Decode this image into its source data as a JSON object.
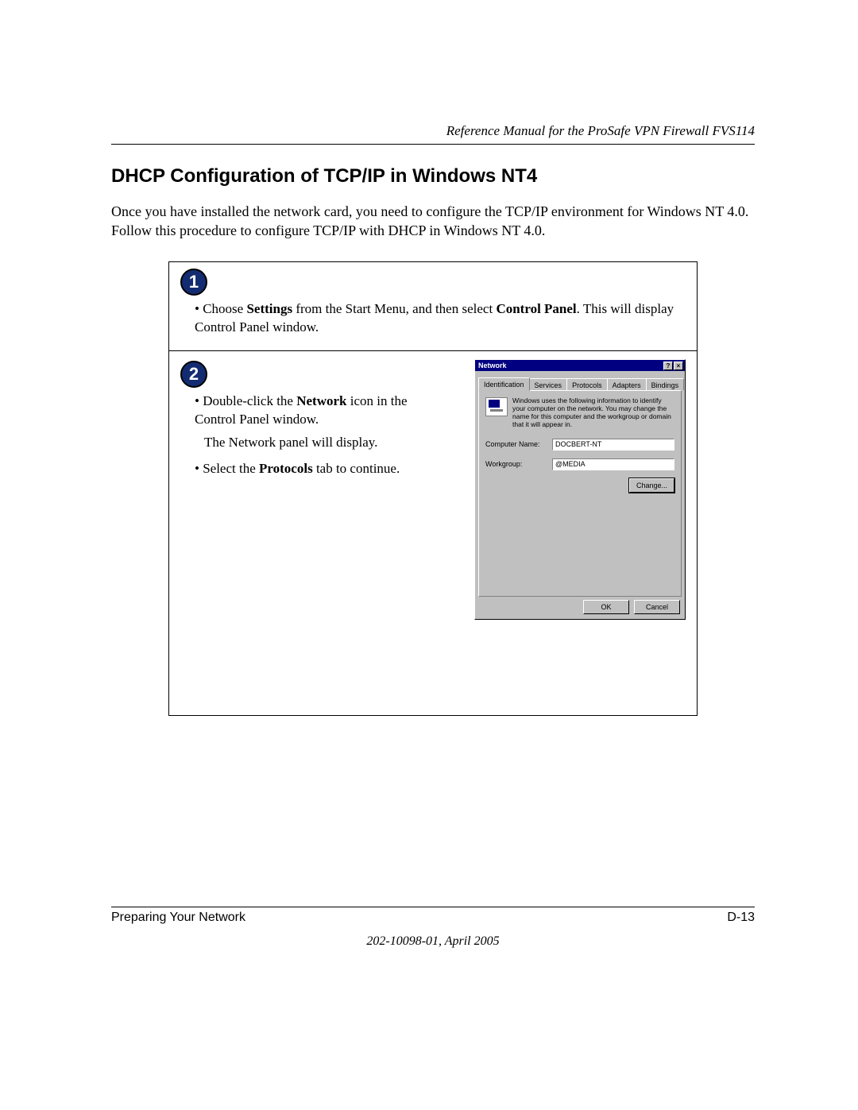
{
  "header": {
    "running_head": "Reference Manual for the ProSafe VPN Firewall FVS114"
  },
  "section": {
    "title": "DHCP Configuration of TCP/IP in Windows NT4",
    "intro": "Once you have installed the network card, you need to configure the TCP/IP environment for Windows NT 4.0. Follow this procedure to configure TCP/IP with DHCP in Windows NT 4.0."
  },
  "steps": {
    "step1": {
      "badge": "1",
      "bullet_prefix": "• Choose ",
      "bold1": "Settings",
      "mid": " from the Start Menu, and then select ",
      "bold2": "Control Panel",
      "suffix": ". This will display Control Panel window."
    },
    "step2": {
      "badge": "2",
      "line1_prefix": "• Double-click the ",
      "line1_bold": "Network",
      "line1_suffix": " icon in the Control Panel window.",
      "line2": "The Network panel will display.",
      "line3_prefix": "• Select the ",
      "line3_bold": "Protocols",
      "line3_suffix": " tab to continue."
    }
  },
  "window": {
    "title": "Network",
    "help_btn": "?",
    "close_btn": "×",
    "tabs": [
      "Identification",
      "Services",
      "Protocols",
      "Adapters",
      "Bindings"
    ],
    "description": "Windows uses the following information to identify your computer on the network. You may change the name for this computer and the workgroup or domain that it will appear in.",
    "fields": {
      "computer_name_label": "Computer Name:",
      "computer_name_value": "DOCBERT-NT",
      "workgroup_label": "Workgroup:",
      "workgroup_value": "@MEDIA"
    },
    "buttons": {
      "change": "Change...",
      "ok": "OK",
      "cancel": "Cancel"
    }
  },
  "footer": {
    "left": "Preparing Your Network",
    "right": "D-13",
    "docid": "202-10098-01, April 2005"
  }
}
